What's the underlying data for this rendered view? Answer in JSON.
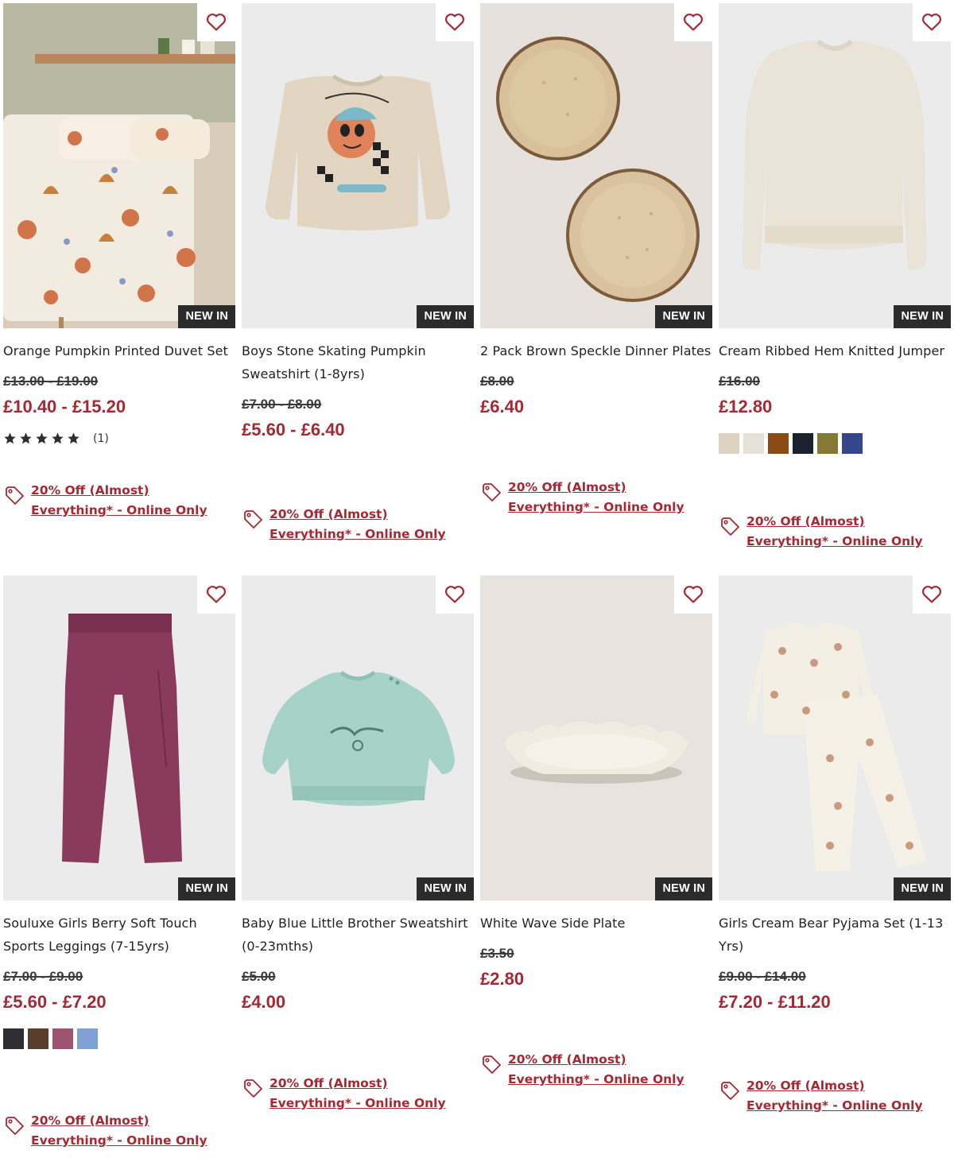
{
  "colors": {
    "price": "#a52833",
    "badge": "#2b2b2b",
    "heart": "#a52833"
  },
  "products": [
    {
      "title": "Orange Pumpkin Printed Duvet Set",
      "badge": "NEW IN",
      "old_price": "£13.00 - £19.00",
      "price": "£10.40 - £15.20",
      "rating": {
        "stars": 5,
        "count": "(1)"
      },
      "swatches": [],
      "promo": "20% Off (Almost) Everything* - Online Only",
      "wishlist_icon": "heart-outline-icon"
    },
    {
      "title": "Boys Stone Skating Pumpkin Sweatshirt (1-8yrs)",
      "badge": "NEW IN",
      "old_price": "£7.00 - £8.00",
      "price": "£5.60 - £6.40",
      "swatches": [],
      "promo": "20% Off (Almost) Everything* - Online Only",
      "wishlist_icon": "heart-outline-icon"
    },
    {
      "title": "2 Pack Brown Speckle Dinner Plates",
      "badge": "NEW IN",
      "old_price": "£8.00",
      "price": "£6.40",
      "swatches": [],
      "promo": "20% Off (Almost) Everything* - Online Only",
      "wishlist_icon": "heart-outline-icon"
    },
    {
      "title": "Cream Ribbed Hem Knitted Jumper",
      "badge": "NEW IN",
      "old_price": "£16.00",
      "price": "£12.80",
      "swatches": [
        "#ddd3c0",
        "#e4e1d9",
        "#8a4b14",
        "#1a2230",
        "#857a33",
        "#34478c"
      ],
      "promo": "20% Off (Almost) Everything* - Online Only",
      "wishlist_icon": "heart-outline-icon"
    },
    {
      "title": "Souluxe Girls Berry Soft Touch Sports Leggings (7-15yrs)",
      "badge": "NEW IN",
      "old_price": "£7.00 - £9.00",
      "price": "£5.60 - £7.20",
      "swatches": [
        "#2e2e33",
        "#5a3e2c",
        "#9c5470",
        "#7fa0d4"
      ],
      "promo": "20% Off (Almost) Everything* - Online Only",
      "wishlist_icon": "heart-outline-icon"
    },
    {
      "title": "Baby Blue Little Brother Sweatshirt (0-23mths)",
      "badge": "NEW IN",
      "old_price": "£5.00",
      "price": "£4.00",
      "swatches": [],
      "promo": "20% Off (Almost) Everything* - Online Only",
      "wishlist_icon": "heart-outline-icon"
    },
    {
      "title": "White Wave Side Plate",
      "badge": "NEW IN",
      "old_price": "£3.50",
      "price": "£2.80",
      "swatches": [],
      "promo": "20% Off (Almost) Everything* - Online Only",
      "wishlist_icon": "heart-outline-icon"
    },
    {
      "title": "Girls Cream Bear Pyjama Set (1-13 Yrs)",
      "badge": "NEW IN",
      "old_price": "£9.00 - £14.00",
      "price": "£7.20 - £11.20",
      "swatches": [],
      "promo": "20% Off (Almost) Everything* - Online Only",
      "wishlist_icon": "heart-outline-icon"
    }
  ]
}
